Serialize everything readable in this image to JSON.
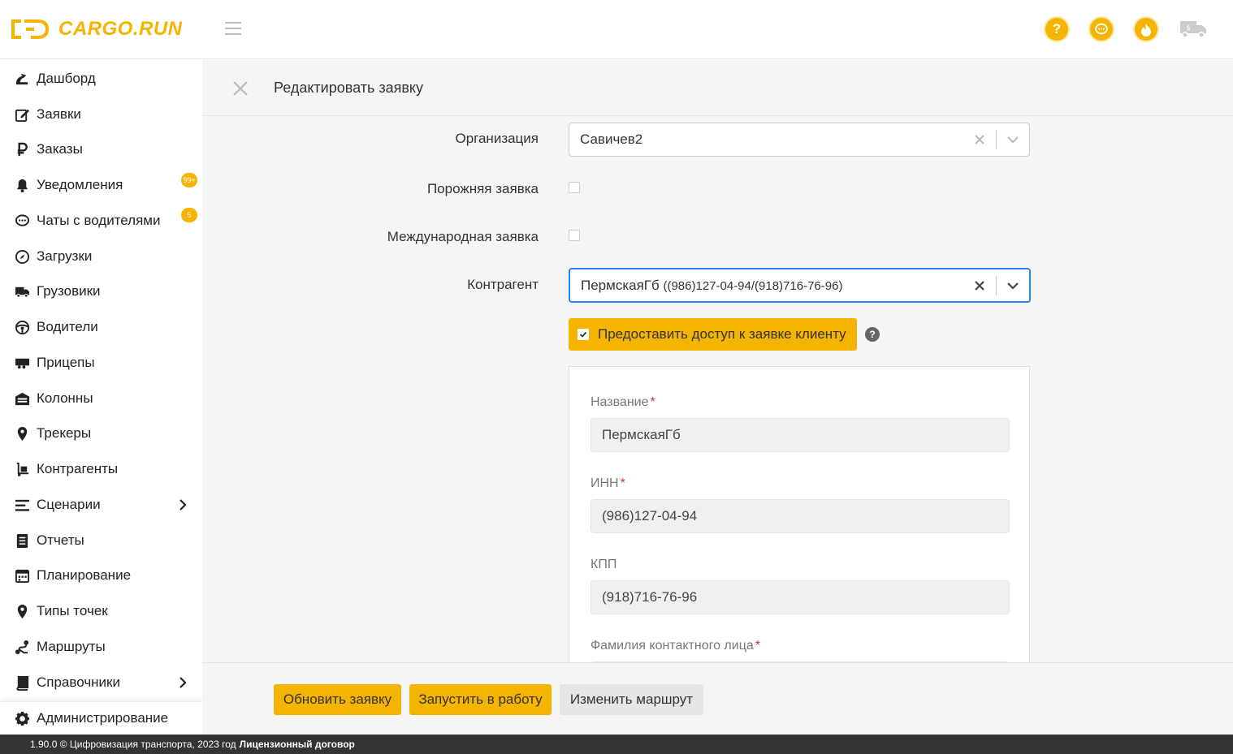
{
  "header": {
    "logo_text": "CARGO.RUN",
    "help_icon_glyph": "?",
    "colors": {
      "accent": "#f5b400",
      "focus": "#2684ff"
    }
  },
  "sidebar": {
    "items": [
      {
        "label": "Дашборд",
        "icon": "dashboard-icon"
      },
      {
        "label": "Заявки",
        "icon": "edit-icon"
      },
      {
        "label": "Заказы",
        "icon": "ruble-icon"
      },
      {
        "label": "Уведомления",
        "icon": "bell-icon",
        "badge": "99+"
      },
      {
        "label": "Чаты с водителями",
        "icon": "chat-icon",
        "badge": "5"
      },
      {
        "label": "Загрузки",
        "icon": "compass-icon"
      },
      {
        "label": "Грузовики",
        "icon": "truck-icon"
      },
      {
        "label": "Водители",
        "icon": "steering-wheel-icon"
      },
      {
        "label": "Прицепы",
        "icon": "trailer-icon"
      },
      {
        "label": "Колонны",
        "icon": "warehouse-icon"
      },
      {
        "label": "Трекеры",
        "icon": "map-pin-icon"
      },
      {
        "label": "Контрагенты",
        "icon": "dolly-icon"
      },
      {
        "label": "Сценарии",
        "icon": "list-icon",
        "has_submenu": true
      },
      {
        "label": "Отчеты",
        "icon": "report-icon"
      },
      {
        "label": "Планирование",
        "icon": "calendar-icon"
      },
      {
        "label": "Типы точек",
        "icon": "map-pin-icon"
      },
      {
        "label": "Маршруты",
        "icon": "route-icon"
      },
      {
        "label": "Справочники",
        "icon": "book-icon",
        "has_submenu": true
      }
    ],
    "admin": {
      "label": "Администрирование",
      "icon": "gear-icon"
    }
  },
  "page": {
    "title": "Редактировать заявку"
  },
  "form": {
    "organization": {
      "label": "Организация",
      "value": "Савичев2"
    },
    "empty_order": {
      "label": "Порожняя заявка",
      "checked": false
    },
    "international_order": {
      "label": "Международная заявка",
      "checked": false
    },
    "counterparty": {
      "label": "Контрагент",
      "value_name": "ПермскаяГб",
      "value_detail": "((986)127-04-94/(918)716-76-96)"
    },
    "share_access": {
      "label": "Предоставить доступ к заявке клиенту",
      "checked": true,
      "help": "?"
    }
  },
  "card": {
    "name": {
      "label": "Название",
      "required_mark": "*",
      "value": "ПермскаяГб"
    },
    "inn": {
      "label": "ИНН",
      "required_mark": "*",
      "value": "(986)127-04-94"
    },
    "kpp": {
      "label": "КПП",
      "value": "(918)716-76-96"
    },
    "contact_lastname": {
      "label": "Фамилия контактного лица",
      "required_mark": "*"
    }
  },
  "actions": {
    "update": "Обновить заявку",
    "start": "Запустить в работу",
    "change_route": "Изменить маршрут"
  },
  "footer": {
    "text": "1.90.0 © Цифровизация транспорта, 2023 год",
    "link": "Лицензионный договор"
  }
}
